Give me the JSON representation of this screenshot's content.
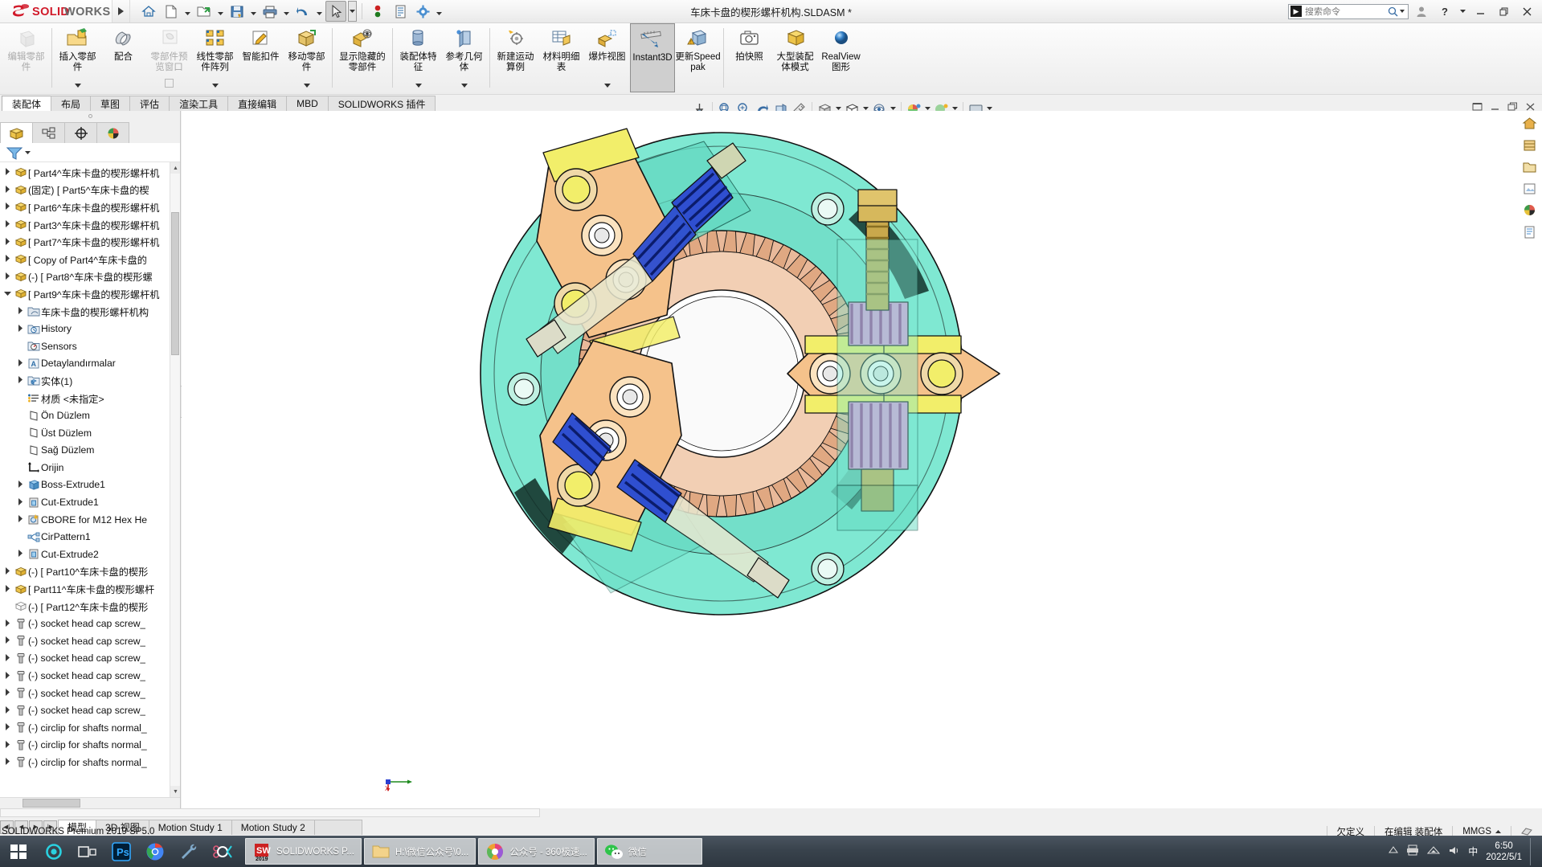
{
  "titlebar": {
    "brand": "SOLIDWORKS",
    "document_title": "车床卡盘的楔形螺杆机构.SLDASM *",
    "quick_access": [
      {
        "name": "home-icon",
        "label": "Home"
      },
      {
        "name": "new-document-icon",
        "label": "New"
      },
      {
        "name": "open-document-icon",
        "label": "Open"
      },
      {
        "name": "save-icon",
        "label": "Save"
      },
      {
        "name": "print-icon",
        "label": "Print"
      },
      {
        "name": "undo-icon",
        "label": "Undo"
      },
      {
        "name": "select-pointer-icon",
        "label": "Select"
      },
      {
        "name": "rebuild-icon",
        "label": "Rebuild"
      },
      {
        "name": "file-properties-icon",
        "label": "File Properties"
      },
      {
        "name": "options-gear-icon",
        "label": "Options"
      }
    ],
    "search_placeholder": "搜索命令",
    "window_controls": {
      "user": "user-icon",
      "help": "?",
      "minimize": "—",
      "restore": "❐",
      "close": "✕"
    }
  },
  "ribbon": {
    "buttons": [
      {
        "label": "编辑零部件",
        "icon": "edit-component-icon",
        "disabled": true,
        "caret": false
      },
      {
        "label": "插入零部件",
        "icon": "insert-component-icon",
        "disabled": false,
        "caret": true
      },
      {
        "label": "配合",
        "icon": "mate-icon",
        "disabled": false,
        "caret": false
      },
      {
        "label": "零部件预览窗口",
        "icon": "component-preview-icon",
        "disabled": true,
        "caret": false
      },
      {
        "label": "线性零部件阵列",
        "icon": "linear-component-pattern-icon",
        "disabled": false,
        "caret": true
      },
      {
        "label": "智能扣件",
        "icon": "smart-fasteners-icon",
        "disabled": false,
        "caret": false
      },
      {
        "label": "移动零部件",
        "icon": "move-component-icon",
        "disabled": false,
        "caret": true
      },
      {
        "label": "显示隐藏的零部件",
        "icon": "show-hidden-components-icon",
        "disabled": false,
        "caret": false
      },
      {
        "label": "装配体特征",
        "icon": "assembly-feature-icon",
        "disabled": false,
        "caret": true
      },
      {
        "label": "参考几何体",
        "icon": "reference-geometry-icon",
        "disabled": false,
        "caret": true
      },
      {
        "label": "新建运动算例",
        "icon": "new-motion-study-icon",
        "disabled": false,
        "caret": false
      },
      {
        "label": "材料明细表",
        "icon": "bill-of-materials-icon",
        "disabled": false,
        "caret": false
      },
      {
        "label": "爆炸视图",
        "icon": "exploded-view-icon",
        "disabled": false,
        "caret": true
      },
      {
        "label": "Instant3D",
        "icon": "instant3d-icon",
        "disabled": false,
        "caret": false,
        "selected": true
      },
      {
        "label": "更新Speedpak",
        "icon": "update-speedpak-icon",
        "disabled": false,
        "caret": false
      },
      {
        "label": "拍快照",
        "icon": "take-snapshot-icon",
        "disabled": false,
        "caret": false
      },
      {
        "label": "大型装配体模式",
        "icon": "large-assembly-mode-icon",
        "disabled": false,
        "caret": false
      },
      {
        "label": "RealView图形",
        "icon": "realview-graphics-icon",
        "disabled": false,
        "caret": false
      }
    ],
    "separators_after": [
      0,
      7,
      9,
      14
    ]
  },
  "tabs": [
    {
      "label": "装配体",
      "active": true
    },
    {
      "label": "布局",
      "active": false
    },
    {
      "label": "草图",
      "active": false
    },
    {
      "label": "评估",
      "active": false
    },
    {
      "label": "渲染工具",
      "active": false
    },
    {
      "label": "直接编辑",
      "active": false
    },
    {
      "label": "MBD",
      "active": false
    },
    {
      "label": "SOLIDWORKS 插件",
      "active": false
    }
  ],
  "view_toolbar": [
    {
      "name": "pin-icon"
    },
    {
      "name": "zoom-to-fit-icon"
    },
    {
      "name": "zoom-to-area-icon"
    },
    {
      "name": "previous-view-icon"
    },
    {
      "name": "section-view-icon"
    },
    {
      "name": "view-orientation-icon"
    },
    {
      "name": "display-style-icon"
    },
    {
      "name": "hide-show-items-icon"
    },
    {
      "name": "edit-appearance-icon"
    },
    {
      "name": "apply-scene-icon"
    },
    {
      "name": "view-setting-icon"
    }
  ],
  "tree": {
    "panel_tabs": [
      {
        "name": "feature-manager-tab",
        "active": true
      },
      {
        "name": "property-manager-tab",
        "active": false
      },
      {
        "name": "configuration-manager-tab",
        "active": false
      },
      {
        "name": "display-manager-tab",
        "active": false
      }
    ],
    "filter_icon": "filter-icon",
    "items": [
      {
        "label": "[ Part4^车床卡盘的楔形螺杆机",
        "icon": "component-icon",
        "indent": 0,
        "expand": "collapsed"
      },
      {
        "label": "(固定) [ Part5^车床卡盘的楔",
        "icon": "component-icon",
        "indent": 0,
        "expand": "collapsed"
      },
      {
        "label": "[ Part6^车床卡盘的楔形螺杆机",
        "icon": "component-icon",
        "indent": 0,
        "expand": "collapsed"
      },
      {
        "label": "[ Part3^车床卡盘的楔形螺杆机",
        "icon": "component-icon",
        "indent": 0,
        "expand": "collapsed"
      },
      {
        "label": "[ Part7^车床卡盘的楔形螺杆机",
        "icon": "component-icon",
        "indent": 0,
        "expand": "collapsed"
      },
      {
        "label": "[ Copy of Part4^车床卡盘的",
        "icon": "component-icon",
        "indent": 0,
        "expand": "collapsed"
      },
      {
        "label": "(-) [ Part8^车床卡盘的楔形螺",
        "icon": "component-icon",
        "indent": 0,
        "expand": "collapsed"
      },
      {
        "label": "[ Part9^车床卡盘的楔形螺杆机",
        "icon": "component-icon",
        "indent": 0,
        "expand": "expanded"
      },
      {
        "label": "车床卡盘的楔形螺杆机构",
        "icon": "annotations-folder-icon",
        "indent": 1,
        "expand": "collapsed"
      },
      {
        "label": "History",
        "icon": "history-icon",
        "indent": 1,
        "expand": "collapsed"
      },
      {
        "label": "Sensors",
        "icon": "sensors-icon",
        "indent": 1,
        "expand": "none"
      },
      {
        "label": "Detaylandırmalar",
        "icon": "annotations-icon",
        "indent": 1,
        "expand": "collapsed"
      },
      {
        "label": "实体(1)",
        "icon": "solid-bodies-icon",
        "indent": 1,
        "expand": "collapsed"
      },
      {
        "label": "材质 <未指定>",
        "icon": "material-icon",
        "indent": 1,
        "expand": "none"
      },
      {
        "label": "Ön Düzlem",
        "icon": "plane-icon",
        "indent": 1,
        "expand": "none"
      },
      {
        "label": "Üst Düzlem",
        "icon": "plane-icon",
        "indent": 1,
        "expand": "none"
      },
      {
        "label": "Sağ Düzlem",
        "icon": "plane-icon",
        "indent": 1,
        "expand": "none"
      },
      {
        "label": "Orijin",
        "icon": "origin-icon",
        "indent": 1,
        "expand": "none"
      },
      {
        "label": "Boss-Extrude1",
        "icon": "boss-extrude-icon",
        "indent": 1,
        "expand": "collapsed"
      },
      {
        "label": "Cut-Extrude1",
        "icon": "cut-extrude-icon",
        "indent": 1,
        "expand": "collapsed"
      },
      {
        "label": "CBORE for M12 Hex He",
        "icon": "hole-wizard-icon",
        "indent": 1,
        "expand": "collapsed"
      },
      {
        "label": "CirPattern1",
        "icon": "circular-pattern-icon",
        "indent": 1,
        "expand": "none"
      },
      {
        "label": "Cut-Extrude2",
        "icon": "cut-extrude-icon",
        "indent": 1,
        "expand": "collapsed"
      },
      {
        "label": "(-) [ Part10^车床卡盘的楔形",
        "icon": "component-icon",
        "indent": 0,
        "expand": "collapsed"
      },
      {
        "label": "[ Part11^车床卡盘的楔形螺杆",
        "icon": "component-icon",
        "indent": 0,
        "expand": "collapsed"
      },
      {
        "label": "(-) [ Part12^车床卡盘的楔形",
        "icon": "component-hidden-icon",
        "indent": 0,
        "expand": "none"
      },
      {
        "label": "(-) socket head cap screw_",
        "icon": "screw-icon",
        "indent": 0,
        "expand": "collapsed"
      },
      {
        "label": "(-) socket head cap screw_",
        "icon": "screw-icon",
        "indent": 0,
        "expand": "collapsed"
      },
      {
        "label": "(-) socket head cap screw_",
        "icon": "screw-icon",
        "indent": 0,
        "expand": "collapsed"
      },
      {
        "label": "(-) socket head cap screw_",
        "icon": "screw-icon",
        "indent": 0,
        "expand": "collapsed"
      },
      {
        "label": "(-) socket head cap screw_",
        "icon": "screw-icon",
        "indent": 0,
        "expand": "collapsed"
      },
      {
        "label": "(-) socket head cap screw_",
        "icon": "screw-icon",
        "indent": 0,
        "expand": "collapsed"
      },
      {
        "label": "(-) circlip for shafts normal_",
        "icon": "screw-icon",
        "indent": 0,
        "expand": "collapsed"
      },
      {
        "label": "(-) circlip for shafts normal_",
        "icon": "screw-icon",
        "indent": 0,
        "expand": "collapsed"
      },
      {
        "label": "(-) circlip for shafts normal_",
        "icon": "screw-icon",
        "indent": 0,
        "expand": "collapsed"
      }
    ]
  },
  "bottom_tabs": [
    {
      "label": "模型",
      "active": true
    },
    {
      "label": "3D 视图",
      "active": false
    },
    {
      "label": "Motion Study 1",
      "active": false
    },
    {
      "label": "Motion Study 2",
      "active": false
    }
  ],
  "statusbar": {
    "left": "SOLIDWORKS Premium 2019 SP5.0",
    "cells": [
      {
        "label": "欠定义"
      },
      {
        "label": "在编辑 装配体"
      },
      {
        "label": "MMGS"
      }
    ]
  },
  "taskbar": {
    "items": [
      {
        "label": "SOLIDWORKS P...",
        "icon": "solidworks-app-icon"
      },
      {
        "label": "H:\\微信公众号\\0...",
        "icon": "folder-icon"
      },
      {
        "label": "公众号 - 360极速...",
        "icon": "browser-icon"
      },
      {
        "label": "微信",
        "icon": "wechat-icon"
      }
    ],
    "pinned": [
      {
        "name": "start-button-icon"
      },
      {
        "name": "cortana-icon"
      },
      {
        "name": "taskview-icon"
      },
      {
        "name": "photoshop-icon"
      },
      {
        "name": "chrome-icon"
      },
      {
        "name": "tool-icon"
      },
      {
        "name": "misc-icon"
      }
    ],
    "clock": {
      "time": "6:50",
      "date": "2022/5/1"
    }
  },
  "colors": {
    "accent": "#d11a2a",
    "ribbon_bg": "#f4f4f4",
    "model_body": "#7fe8d2",
    "model_jaw": "#f5c28b",
    "model_worm": "#2f4fd0",
    "model_gear": "#e6a882",
    "model_screw": "#e09ad8",
    "model_yellow": "#f2ee6a",
    "model_outline": "#1a1a1a"
  },
  "model": {
    "name": "lathe-chuck-wedge-screw-mechanism",
    "description": "3-jaw lathe chuck assembly shown in isometric-front view"
  }
}
